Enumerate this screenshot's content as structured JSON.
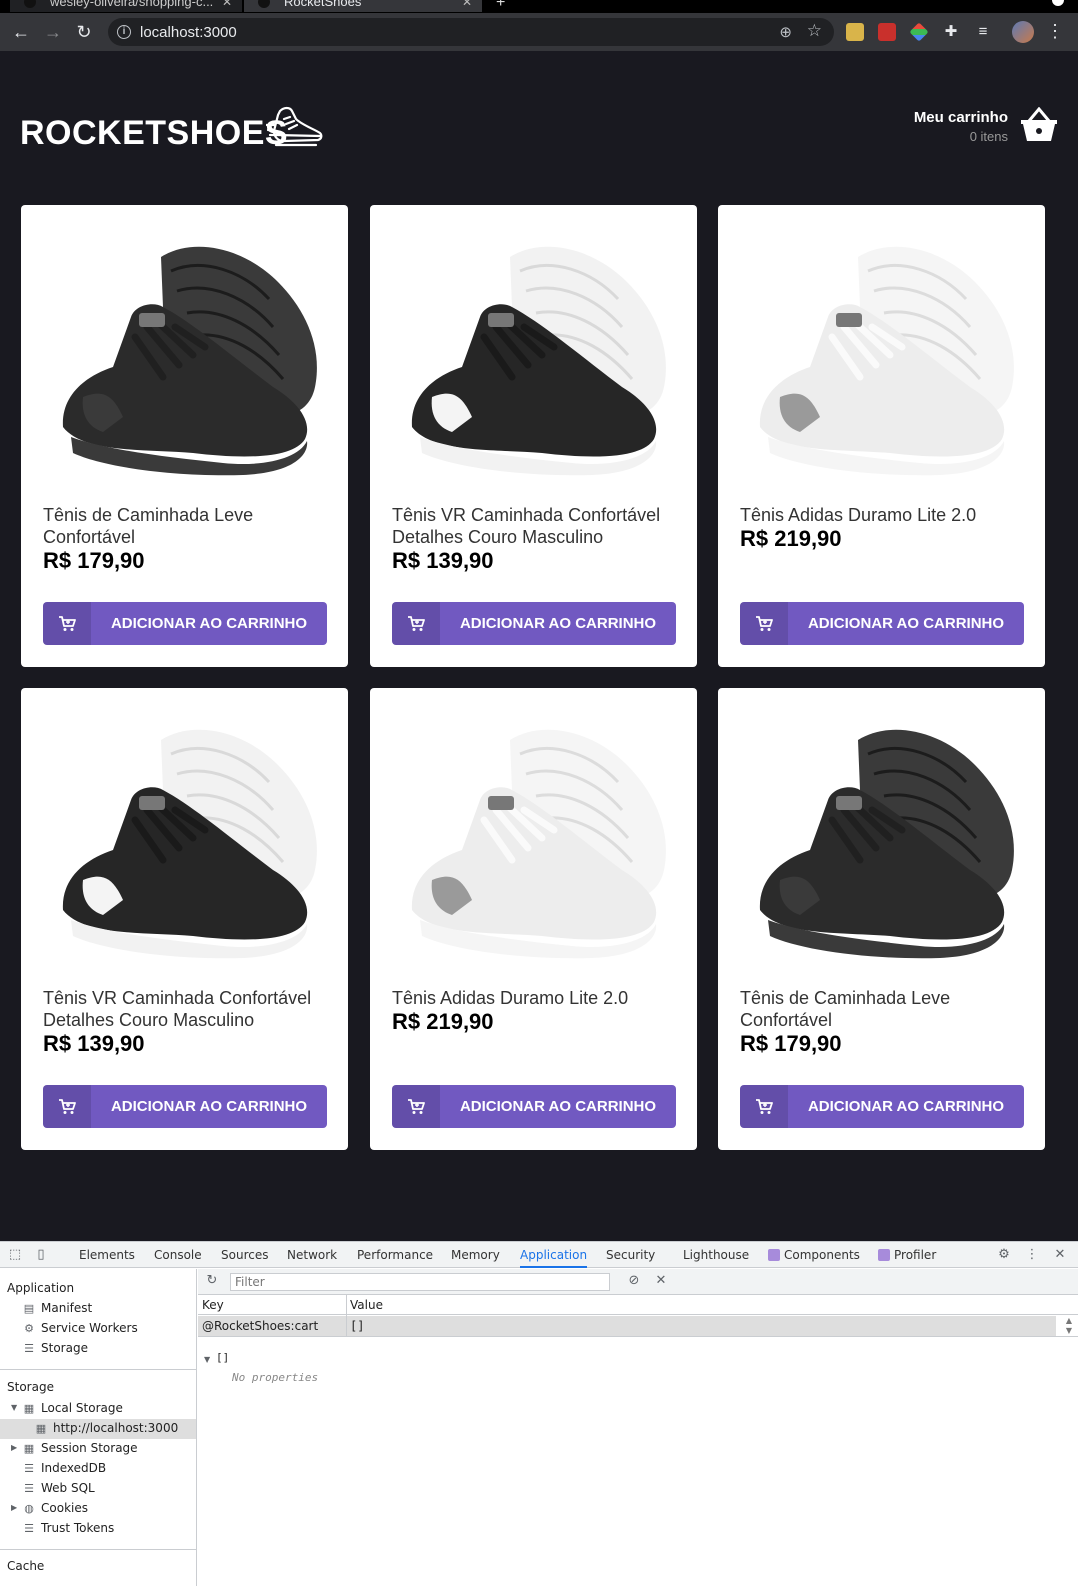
{
  "browser": {
    "tabs": [
      {
        "title": "wesley-oliveira/shopping-c..."
      },
      {
        "title": "RocketShoes"
      }
    ],
    "url": "localhost:3000"
  },
  "header": {
    "logo_text": "ROCKETSHOES",
    "cart_title": "Meu carrinho",
    "cart_count": "0 itens"
  },
  "products": [
    {
      "name": "Tênis de Caminhada Leve Confortável",
      "price": "R$ 179,90",
      "colorway": "black",
      "button": "ADICIONAR AO CARRINHO"
    },
    {
      "name": "Tênis VR Caminhada Confortável Detalhes Couro Masculino",
      "price": "R$ 139,90",
      "colorway": "black-white",
      "button": "ADICIONAR AO CARRINHO"
    },
    {
      "name": "Tênis Adidas Duramo Lite 2.0",
      "price": "R$ 219,90",
      "colorway": "white-grey",
      "button": "ADICIONAR AO CARRINHO"
    },
    {
      "name": "Tênis VR Caminhada Confortável Detalhes Couro Masculino",
      "price": "R$ 139,90",
      "colorway": "black-white",
      "button": "ADICIONAR AO CARRINHO"
    },
    {
      "name": "Tênis Adidas Duramo Lite 2.0",
      "price": "R$ 219,90",
      "colorway": "white-grey",
      "button": "ADICIONAR AO CARRINHO"
    },
    {
      "name": "Tênis de Caminhada Leve Confortável",
      "price": "R$ 179,90",
      "colorway": "black",
      "button": "ADICIONAR AO CARRINHO"
    }
  ],
  "colors": {
    "accent": "#7159c1",
    "background": "#191920"
  },
  "devtools": {
    "tabs": [
      "Elements",
      "Console",
      "Sources",
      "Network",
      "Performance",
      "Memory",
      "Application",
      "Security",
      "Lighthouse",
      "Components",
      "Profiler"
    ],
    "active_tab": "Application",
    "sidebar": {
      "application_heading": "Application",
      "application_items": [
        "Manifest",
        "Service Workers",
        "Storage"
      ],
      "storage_heading": "Storage",
      "local_storage": "Local Storage",
      "local_storage_origin": "http://localhost:3000",
      "storage_items": [
        "Session Storage",
        "IndexedDB",
        "Web SQL",
        "Cookies",
        "Trust Tokens"
      ],
      "cache_heading": "Cache"
    },
    "filter_placeholder": "Filter",
    "table": {
      "key_header": "Key",
      "value_header": "Value",
      "row_key": "@RocketShoes:cart",
      "row_value": "[]"
    },
    "preview": {
      "root": "[]",
      "empty": "No properties"
    }
  }
}
